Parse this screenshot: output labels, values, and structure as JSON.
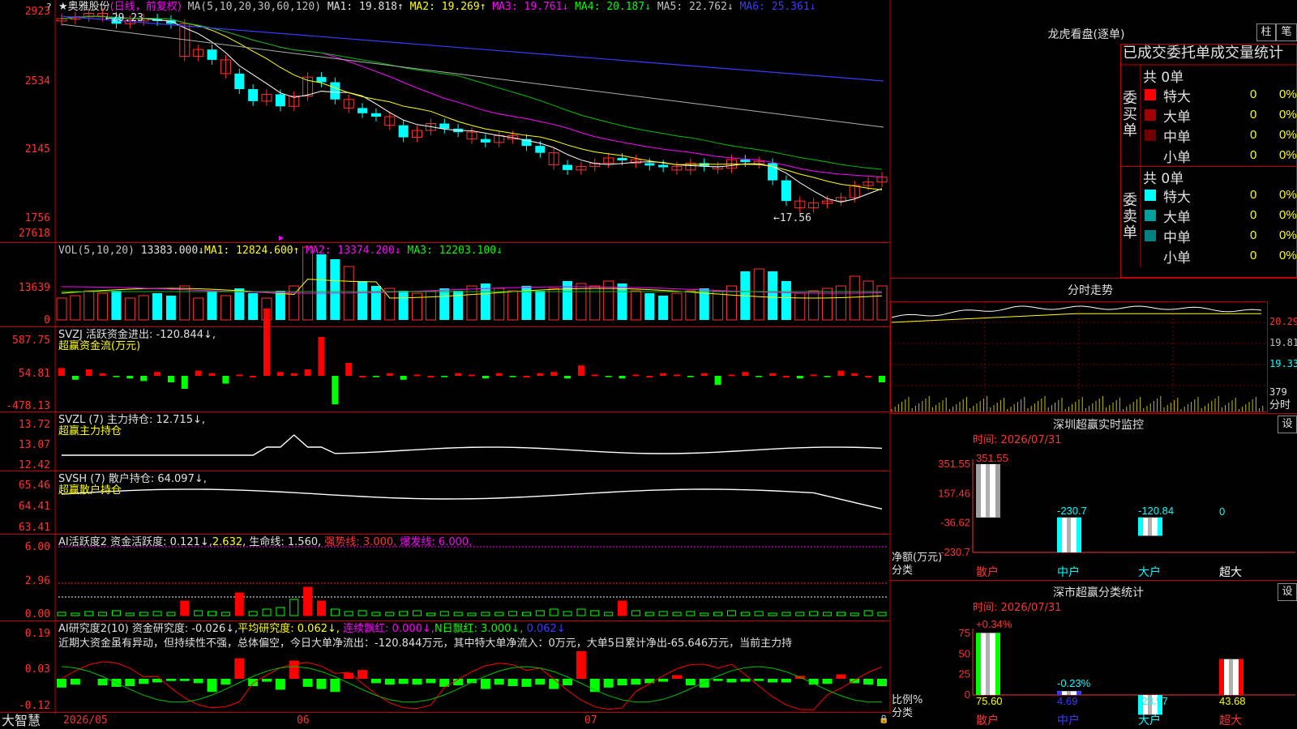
{
  "main_chart": {
    "star": "★",
    "stock_name": "奥雅股份",
    "period": "(日线，前复权)",
    "ma_label": "MA(5,10,20,30,60,120)",
    "ma": [
      {
        "label": "MA1: 19.818↑",
        "color": "#e0e0e0"
      },
      {
        "label": "MA2: 19.269↑",
        "color": "#ffff00"
      },
      {
        "label": "MA3: 19.761↓",
        "color": "#ff00ff"
      },
      {
        "label": "MA4: 20.187↓",
        "color": "#00ff00"
      },
      {
        "label": "MA5: 22.762↓",
        "color": "#c0c0c0"
      },
      {
        "label": "MA6: 25.361↓",
        "color": "#3b3bff"
      }
    ],
    "y_ticks": [
      "2923",
      "2534",
      "2145",
      "1756"
    ],
    "high_note": "29.23",
    "low_note": "17.56",
    "question_mark": "?"
  },
  "vol_panel": {
    "label": "VOL(5,10,20)",
    "value": "13383.000↓",
    "ma1": "MA1: 12824.600↑",
    "ma2": "MA2: 13374.200↓",
    "ma3": "MA3: 12203.100↓",
    "y_ticks": [
      "27618",
      "13639",
      "0"
    ]
  },
  "svzj_panel": {
    "label": "SVZJ  活跃资金进出: -120.844↓,",
    "sub": "超赢资金流(万元)",
    "y_ticks": [
      "587.75",
      "54.81",
      "-478.13"
    ]
  },
  "svzl_panel": {
    "label": "SVZL (7) 主力持仓: 12.715↓,",
    "sub": "超赢主力持仓",
    "y_ticks": [
      "13.72",
      "13.07",
      "12.42"
    ]
  },
  "svsh_panel": {
    "label": "SVSH (7) 散户持仓: 64.097↓,",
    "sub": "超赢散户持仓",
    "y_ticks": [
      "65.46",
      "64.41",
      "63.41"
    ]
  },
  "ai_active_panel": {
    "label": "AI活跃度2 资金活跃度: 0.121↓,",
    "v2": "2.632,",
    "life": "生命线: 1.560,",
    "strong": "强势线: 3.000,",
    "burst": "爆发线: 6.000,",
    "y_ticks": [
      "6.00",
      "2.96",
      "0.00"
    ]
  },
  "ai_research_panel": {
    "label": "AI研究度2(10) 资金研究度: -0.026↓,",
    "avg": "平均研究度: 0.062↓,",
    "cont": "连续飘红: 0.000↓,",
    "nday": "N日飘红: 3.000↓,",
    "last": "0.062↓",
    "comment": "近期大资金虽有异动，但持续性不强，总体偏空，今日大单净流出：-120.844万元，其中特大单净流入：0万元，大单5日累计净出-65.646万元，当前主力持",
    "y_ticks": [
      "0.19",
      "0.03",
      "-0.12"
    ]
  },
  "x_axis": {
    "brand": "大智慧",
    "labels": [
      "2026/05",
      "06",
      "07"
    ]
  },
  "dragon_tiger": {
    "title": "龙虎看盘(逐单)",
    "btn_bar": "柱",
    "btn_pen": "笔",
    "heading": "已成交委托单成交量统计",
    "buy_label": "委买单",
    "sell_label": "委卖单",
    "buy_total": "共 0单",
    "sell_total": "共 0单",
    "buy_rows": [
      {
        "name": "特大",
        "count": "0",
        "pct": "0%",
        "color": "#ff0000"
      },
      {
        "name": "大单",
        "count": "0",
        "pct": "0%",
        "color": "#a00000"
      },
      {
        "name": "中单",
        "count": "0",
        "pct": "0%",
        "color": "#700000"
      },
      {
        "name": "小单",
        "count": "0",
        "pct": "0%",
        "color": "#000000"
      }
    ],
    "sell_rows": [
      {
        "name": "特大",
        "count": "0",
        "pct": "0%",
        "color": "#00ffff"
      },
      {
        "name": "大单",
        "count": "0",
        "pct": "0%",
        "color": "#00a0a0"
      },
      {
        "name": "中单",
        "count": "0",
        "pct": "0%",
        "color": "#008080"
      },
      {
        "name": "小单",
        "count": "0",
        "pct": "0%",
        "color": "#000000"
      }
    ]
  },
  "intraday": {
    "title": "分时走势",
    "price_labels": [
      "20.29",
      "19.81",
      "19.33"
    ],
    "vol_label": "379",
    "vol_unit": "分时"
  },
  "sz_monitor": {
    "title": "深圳超赢实时监控",
    "settings": "设",
    "time": "时间: 2026/07/31",
    "y_ticks": [
      "351.55",
      "157.46",
      "-36.62",
      "-230.7"
    ],
    "axis_title": "净额(万元)",
    "axis_sub": "分类",
    "chart_data": {
      "type": "bar",
      "categories": [
        "散户",
        "中户",
        "大户",
        "超大"
      ],
      "values": [
        351.55,
        -230.7,
        -120.84,
        0
      ],
      "value_labels": [
        "351.55",
        "-230.7",
        "-120.84",
        "0"
      ],
      "ylim": [
        -230.7,
        351.55
      ]
    }
  },
  "sz_class": {
    "title": "深市超赢分类统计",
    "settings": "设",
    "time": "时间: 2026/07/31",
    "y_ticks": [
      "75",
      "50",
      "25",
      "0"
    ],
    "axis_title": "比例%",
    "axis_sub": "分类",
    "chart_data": {
      "type": "bar",
      "categories": [
        "散户",
        "中户",
        "大户",
        "超大"
      ],
      "values": [
        75.6,
        4.69,
        -23.97,
        43.68
      ],
      "value_labels": [
        "75.60",
        "4.69",
        "-23.97",
        "43.68"
      ],
      "changes": [
        "+0.34%",
        "-0.23%",
        "",
        ""
      ],
      "ylim": [
        0,
        75
      ]
    }
  }
}
